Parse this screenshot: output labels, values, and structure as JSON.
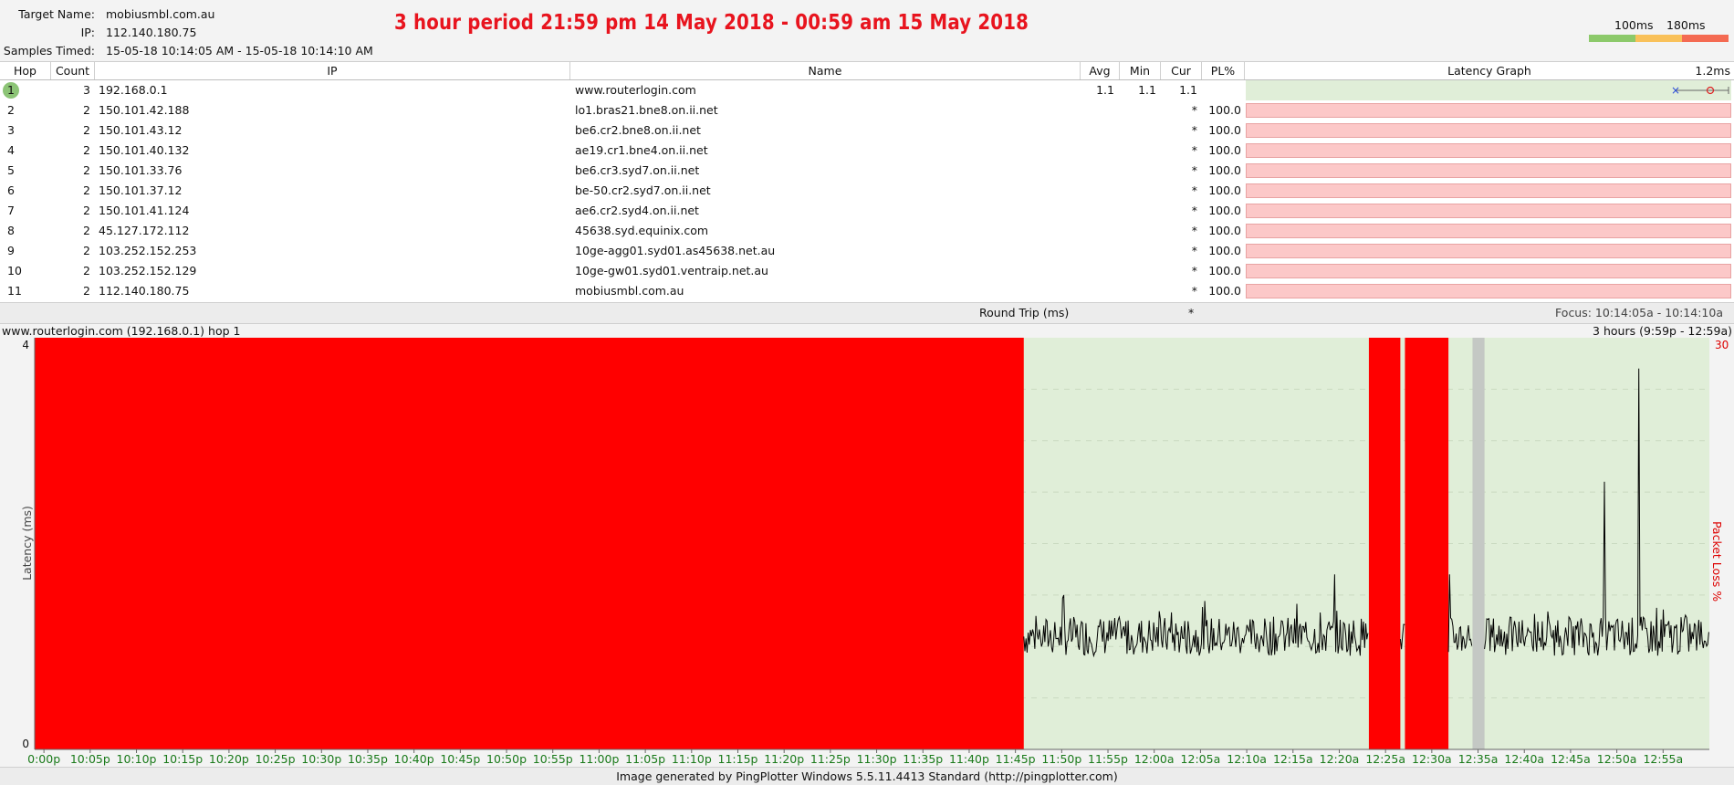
{
  "header": {
    "target_name_label": "Target Name:",
    "target_name": "mobiusmbl.com.au",
    "ip_label": "IP:",
    "ip": "112.140.180.75",
    "samples_label": "Samples Timed:",
    "samples": "15-05-18 10:14:05 AM - 15-05-18 10:14:10 AM",
    "period_caption": "3 hour period 21:59 pm 14 May 2018 - 00:59 am 15 May 2018",
    "threshold_1": "100ms",
    "threshold_2": "180ms",
    "colors": {
      "good": "#8cc96a",
      "warn": "#f9c15a",
      "bad": "#f46a52"
    }
  },
  "table": {
    "columns": {
      "hop": "Hop",
      "count": "Count",
      "ip": "IP",
      "name": "Name",
      "avg": "Avg",
      "min": "Min",
      "cur": "Cur",
      "pl": "PL%",
      "graph": "Latency Graph",
      "graph_scale": "1.2ms"
    },
    "rows": [
      {
        "hop": "1",
        "count": "3",
        "ip": "192.168.0.1",
        "name": "www.routerlogin.com",
        "avg": "1.1",
        "min": "1.1",
        "cur": "1.1",
        "pl": "",
        "status": "ok"
      },
      {
        "hop": "2",
        "count": "2",
        "ip": "150.101.42.188",
        "name": "lo1.bras21.bne8.on.ii.net",
        "avg": "",
        "min": "",
        "cur": "*",
        "pl": "100.0",
        "status": "loss"
      },
      {
        "hop": "3",
        "count": "2",
        "ip": "150.101.43.12",
        "name": "be6.cr2.bne8.on.ii.net",
        "avg": "",
        "min": "",
        "cur": "*",
        "pl": "100.0",
        "status": "loss"
      },
      {
        "hop": "4",
        "count": "2",
        "ip": "150.101.40.132",
        "name": "ae19.cr1.bne4.on.ii.net",
        "avg": "",
        "min": "",
        "cur": "*",
        "pl": "100.0",
        "status": "loss"
      },
      {
        "hop": "5",
        "count": "2",
        "ip": "150.101.33.76",
        "name": "be6.cr3.syd7.on.ii.net",
        "avg": "",
        "min": "",
        "cur": "*",
        "pl": "100.0",
        "status": "loss"
      },
      {
        "hop": "6",
        "count": "2",
        "ip": "150.101.37.12",
        "name": "be-50.cr2.syd7.on.ii.net",
        "avg": "",
        "min": "",
        "cur": "*",
        "pl": "100.0",
        "status": "loss"
      },
      {
        "hop": "7",
        "count": "2",
        "ip": "150.101.41.124",
        "name": "ae6.cr2.syd4.on.ii.net",
        "avg": "",
        "min": "",
        "cur": "*",
        "pl": "100.0",
        "status": "loss"
      },
      {
        "hop": "8",
        "count": "2",
        "ip": "45.127.172.112",
        "name": "45638.syd.equinix.com",
        "avg": "",
        "min": "",
        "cur": "*",
        "pl": "100.0",
        "status": "loss"
      },
      {
        "hop": "9",
        "count": "2",
        "ip": "103.252.152.253",
        "name": "10ge-agg01.syd01.as45638.net.au",
        "avg": "",
        "min": "",
        "cur": "*",
        "pl": "100.0",
        "status": "loss"
      },
      {
        "hop": "10",
        "count": "2",
        "ip": "103.252.152.129",
        "name": "10ge-gw01.syd01.ventraip.net.au",
        "avg": "",
        "min": "",
        "cur": "*",
        "pl": "100.0",
        "status": "loss"
      },
      {
        "hop": "11",
        "count": "2",
        "ip": "112.140.180.75",
        "name": "mobiusmbl.com.au",
        "avg": "",
        "min": "",
        "cur": "*",
        "pl": "100.0",
        "status": "loss"
      }
    ],
    "round_trip_label": "Round Trip (ms)",
    "round_trip_cur": "*",
    "focus": "Focus: 10:14:05a - 10:14:10a"
  },
  "graph": {
    "title": "www.routerlogin.com (192.168.0.1) hop 1",
    "range_label": "3 hours (9:59p - 12:59a)"
  },
  "chart_data": {
    "type": "line",
    "ylabel": "Latency (ms)",
    "y2label": "Packet Loss %",
    "ylim": [
      0,
      4
    ],
    "y_ticks": [
      "4",
      "0"
    ],
    "y2_top": "30",
    "x_tick_labels": [
      "0:00p",
      "10:05p",
      "10:10p",
      "10:15p",
      "10:20p",
      "10:25p",
      "10:30p",
      "10:35p",
      "10:40p",
      "10:45p",
      "10:50p",
      "10:55p",
      "11:00p",
      "11:05p",
      "11:10p",
      "11:15p",
      "11:20p",
      "11:25p",
      "11:30p",
      "11:35p",
      "11:40p",
      "11:45p",
      "11:50p",
      "11:55p",
      "12:00a",
      "12:05a",
      "12:10a",
      "12:15a",
      "12:20a",
      "12:25a",
      "12:30a",
      "12:35a",
      "12:40a",
      "12:45a",
      "12:50a",
      "12:55a"
    ],
    "time_range_minutes": [
      -1,
      180
    ],
    "loss_periods_minutes": [
      [
        -1,
        105.9
      ],
      [
        143.2,
        146.6
      ],
      [
        147.1,
        151.8
      ]
    ],
    "gap_periods_minutes": [
      [
        154.4,
        155.7
      ]
    ],
    "latency_series": {
      "name": "",
      "baseline_ms": 1.1,
      "spikes": [
        {
          "t": 110.2,
          "ms": 1.5
        },
        {
          "t": 139.5,
          "ms": 1.7
        },
        {
          "t": 151.9,
          "ms": 1.7
        },
        {
          "t": 172.4,
          "ms": 3.7
        },
        {
          "t": 168.7,
          "ms": 2.6
        }
      ]
    },
    "colors": {
      "loss": "#ff0000",
      "ok_bg": "#e0eed8",
      "gap": "#c4c8c4",
      "line": "#000000",
      "axis_label": "#1a7a1a"
    },
    "grid": true
  },
  "footer": "Image generated by PingPlotter Windows 5.5.11.4413 Standard (http://pingplotter.com)"
}
